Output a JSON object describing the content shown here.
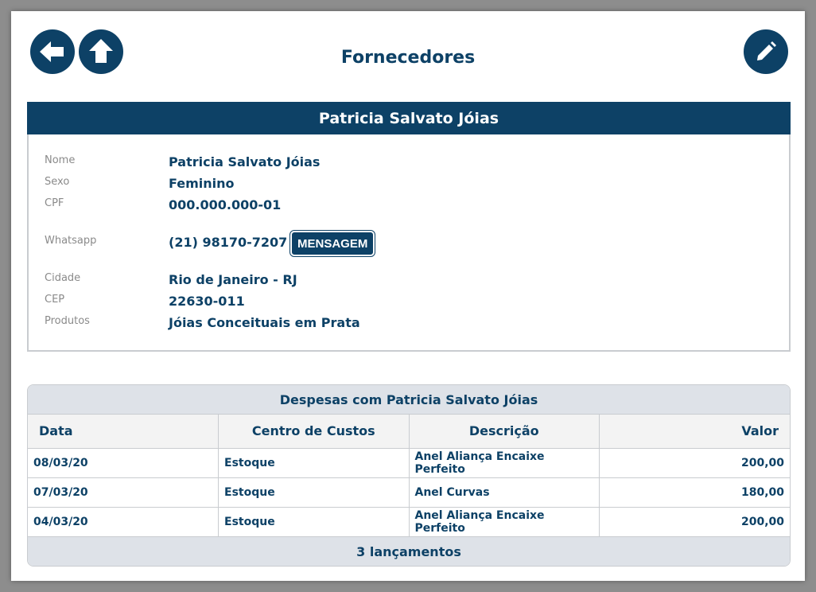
{
  "page": {
    "title": "Fornecedores"
  },
  "toolbar": {
    "back_icon": "arrow-left-icon",
    "up_icon": "arrow-up-icon",
    "edit_icon": "pencil-icon"
  },
  "supplier": {
    "header": "Patricia Salvato Jóias",
    "fields": {
      "nome": {
        "label": "Nome",
        "value": "Patricia Salvato Jóias"
      },
      "sexo": {
        "label": "Sexo",
        "value": "Feminino"
      },
      "cpf": {
        "label": "CPF",
        "value": "000.000.000-01"
      },
      "whatsapp": {
        "label": "Whatsapp",
        "value": "(21) 98170-7207"
      },
      "cidade": {
        "label": "Cidade",
        "value": "Rio de Janeiro - RJ"
      },
      "cep": {
        "label": "CEP",
        "value": "22630-011"
      },
      "produtos": {
        "label": "Produtos",
        "value": "Jóias Conceituais em Prata"
      }
    },
    "message_button": "MENSAGEM"
  },
  "expenses": {
    "title": "Despesas com Patricia Salvato Jóias",
    "columns": [
      "Data",
      "Centro de Custos",
      "Descrição",
      "Valor"
    ],
    "rows": [
      [
        "08/03/20",
        "Estoque",
        "Anel Aliança Encaixe Perfeito",
        "200,00"
      ],
      [
        "07/03/20",
        "Estoque",
        "Anel Curvas",
        "180,00"
      ],
      [
        "04/03/20",
        "Estoque",
        "Anel Aliança Encaixe Perfeito",
        "200,00"
      ]
    ],
    "footer": "3 lançamentos"
  },
  "colors": {
    "primary": "#0d4166",
    "header_bg": "#dee2e8",
    "label_gray": "#8a8a8a"
  }
}
